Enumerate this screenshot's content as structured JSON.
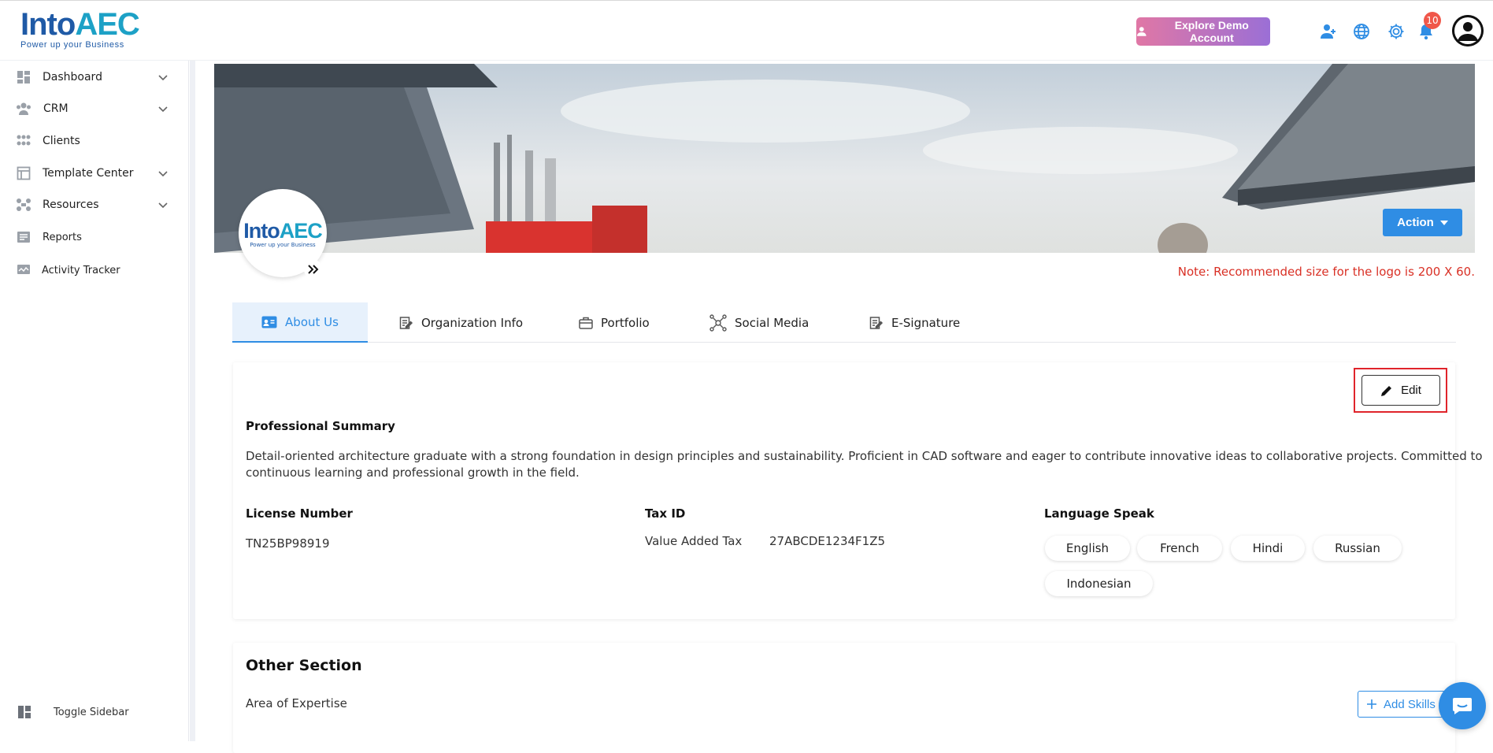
{
  "brand": {
    "name_part1": "Into",
    "name_part2": "AEC",
    "tagline": "Power up your Business"
  },
  "header": {
    "demo_button": "Explore Demo Account",
    "notification_count": "10",
    "icons": [
      "add-user-icon",
      "globe-icon",
      "gear-icon",
      "bell-icon",
      "user-avatar"
    ]
  },
  "sidebar": {
    "items": [
      {
        "label": "Dashboard",
        "icon": "dashboard-icon",
        "has_children": true
      },
      {
        "label": "CRM",
        "icon": "crm-icon",
        "has_children": true
      },
      {
        "label": "Clients",
        "icon": "clients-icon",
        "has_children": false
      },
      {
        "label": "Template Center",
        "icon": "template-icon",
        "has_children": true
      },
      {
        "label": "Resources",
        "icon": "resources-icon",
        "has_children": true
      },
      {
        "label": "Reports",
        "icon": "reports-icon",
        "has_children": false
      },
      {
        "label": "Activity Tracker",
        "icon": "activity-icon",
        "has_children": false
      }
    ],
    "toggle_label": "Toggle Sidebar"
  },
  "banner": {
    "action_label": "Action",
    "logo_note": "Note: Recommended size for the logo is 200 X 60."
  },
  "tabs": [
    {
      "label": "About Us",
      "active": true
    },
    {
      "label": "Organization Info",
      "active": false
    },
    {
      "label": "Portfolio",
      "active": false
    },
    {
      "label": "Social Media",
      "active": false
    },
    {
      "label": "E-Signature",
      "active": false
    }
  ],
  "about": {
    "edit_label": "Edit",
    "summary_heading": "Professional Summary",
    "summary_line1": "Detail-oriented architecture graduate with a strong foundation in design principles and sustainability. Proficient in CAD software and eager to contribute innovative ideas to collaborative projects. Committed to",
    "summary_line2": "continuous learning and professional growth in the field.",
    "license_heading": "License Number",
    "license_value": "TN25BP98919",
    "tax_heading": "Tax ID",
    "tax_type": "Value Added Tax",
    "tax_value": "27ABCDE1234F1Z5",
    "language_heading": "Language Speak",
    "languages": [
      "English",
      "French",
      "Hindi",
      "Russian",
      "Indonesian"
    ]
  },
  "other": {
    "title": "Other Section",
    "expertise_label": "Area of Expertise",
    "add_skills_label": "Add Skills"
  },
  "colors": {
    "accent": "#2f8de4",
    "danger": "#d93025",
    "brand": "#1f5aa6"
  }
}
